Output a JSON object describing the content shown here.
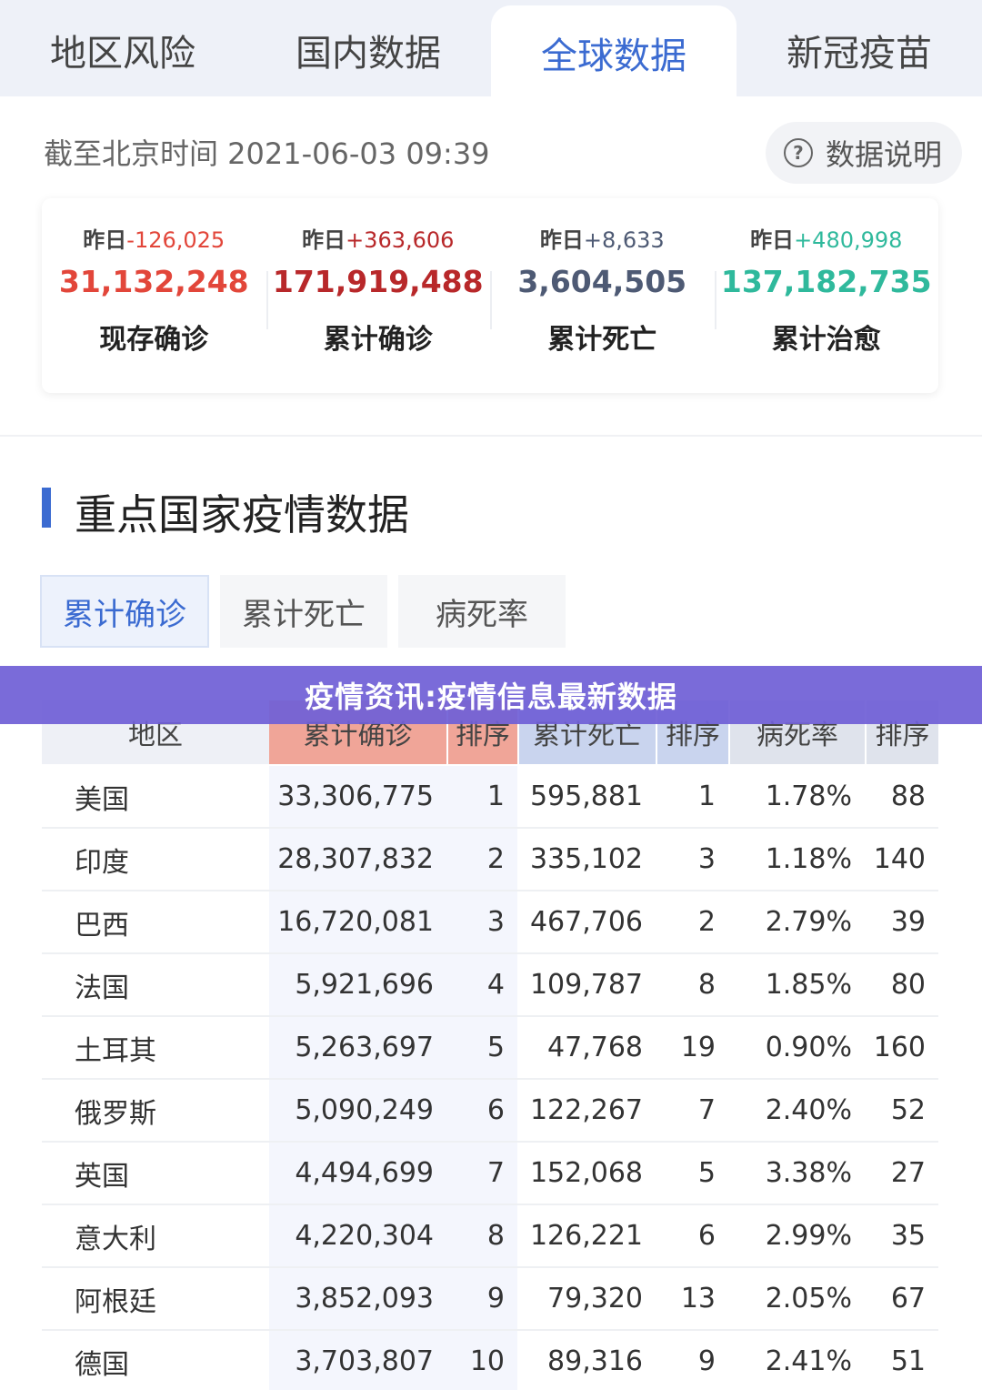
{
  "tabs": [
    "地区风险",
    "国内数据",
    "全球数据",
    "新冠疫苗"
  ],
  "active_tab": 2,
  "timestamp": "截至北京时间 2021-06-03 09:39",
  "data_note": "数据说明",
  "stats": [
    {
      "yesterday_label": "昨日",
      "delta": "-126,025",
      "value": "31,132,248",
      "label": "现存确诊",
      "color": "#e2463a"
    },
    {
      "yesterday_label": "昨日",
      "delta": "+363,606",
      "value": "171,919,488",
      "label": "累计确诊",
      "color": "#b8282a"
    },
    {
      "yesterday_label": "昨日",
      "delta": "+8,633",
      "value": "3,604,505",
      "label": "累计死亡",
      "color": "#4e5a74"
    },
    {
      "yesterday_label": "昨日",
      "delta": "+480,998",
      "value": "137,182,735",
      "label": "累计治愈",
      "color": "#2fb99c"
    }
  ],
  "section_title": "重点国家疫情数据",
  "sub_tabs": [
    "累计确诊",
    "累计死亡",
    "病死率"
  ],
  "table": {
    "headers": [
      "地区",
      "累计确诊",
      "排序",
      "累计死亡",
      "排序",
      "病死率",
      "排序"
    ],
    "rows": [
      [
        "美国",
        "33,306,775",
        "1",
        "595,881",
        "1",
        "1.78%",
        "88"
      ],
      [
        "印度",
        "28,307,832",
        "2",
        "335,102",
        "3",
        "1.18%",
        "140"
      ],
      [
        "巴西",
        "16,720,081",
        "3",
        "467,706",
        "2",
        "2.79%",
        "39"
      ],
      [
        "法国",
        "5,921,696",
        "4",
        "109,787",
        "8",
        "1.85%",
        "80"
      ],
      [
        "土耳其",
        "5,263,697",
        "5",
        "47,768",
        "19",
        "0.90%",
        "160"
      ],
      [
        "俄罗斯",
        "5,090,249",
        "6",
        "122,267",
        "7",
        "2.40%",
        "52"
      ],
      [
        "英国",
        "4,494,699",
        "7",
        "152,068",
        "5",
        "3.38%",
        "27"
      ],
      [
        "意大利",
        "4,220,304",
        "8",
        "126,221",
        "6",
        "2.99%",
        "35"
      ],
      [
        "阿根廷",
        "3,852,093",
        "9",
        "79,320",
        "13",
        "2.05%",
        "67"
      ],
      [
        "德国",
        "3,703,807",
        "10",
        "89,316",
        "9",
        "2.41%",
        "51"
      ]
    ]
  },
  "banner": "疫情资讯:疫情信息最新数据",
  "colors": {
    "accent": "#3b6bd1",
    "cases_header": "#f0a598",
    "deaths_header": "#c9d4ee",
    "rate_header": "#dfe3ec",
    "banner": "#7060d6"
  }
}
